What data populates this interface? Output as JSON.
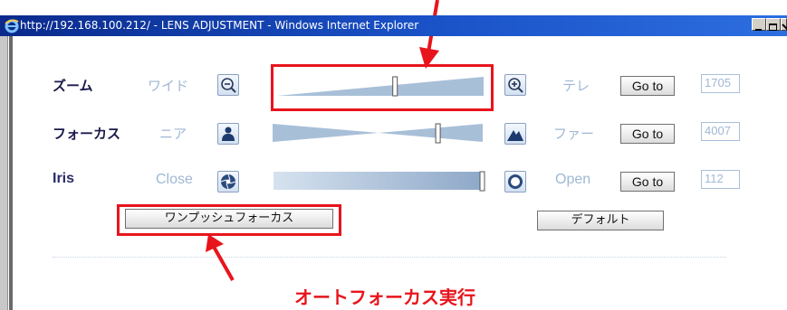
{
  "window": {
    "title": "http://192.168.100.212/ - LENS ADJUSTMENT - Windows Internet Explorer"
  },
  "rows": [
    {
      "label": "ズーム",
      "min_label": "ワイド",
      "max_label": "テレ",
      "goto_label": "Go to",
      "value": "1705",
      "slider_position": 0.57
    },
    {
      "label": "フォーカス",
      "min_label": "ニア",
      "max_label": "ファー",
      "goto_label": "Go to",
      "value": "4007",
      "slider_position": 0.79
    },
    {
      "label": "Iris",
      "min_label": "Close",
      "max_label": "Open",
      "goto_label": "Go to",
      "value": "112",
      "slider_position": 1.0
    }
  ],
  "buttons": {
    "one_push_focus": "ワンプッシュフォーカス",
    "default": "デフォルト"
  },
  "annotation": {
    "text": "オートフォーカス実行"
  },
  "colors": {
    "highlight": "#e8141c",
    "label": "#1a1a4a",
    "muted": "#9fb7d4",
    "slider": "#a8bfd8"
  }
}
